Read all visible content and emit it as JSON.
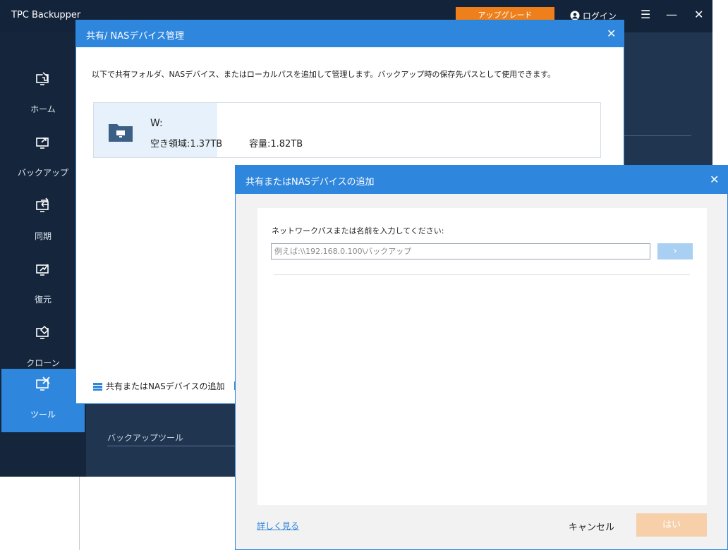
{
  "app": {
    "title": "TPC Backupper",
    "upgrade_label": "アップグレード",
    "login_label": "ログイン",
    "menu_glyph": "☰",
    "minimize_glyph": "—",
    "close_glyph": "✕"
  },
  "sidebar": {
    "items": [
      {
        "label": "ホーム",
        "icon": "home-icon"
      },
      {
        "label": "バックアップ",
        "icon": "backup-icon"
      },
      {
        "label": "同期",
        "icon": "sync-icon"
      },
      {
        "label": "復元",
        "icon": "restore-icon"
      },
      {
        "label": "クローン",
        "icon": "clone-icon"
      },
      {
        "label": "ツール",
        "icon": "tools-icon",
        "active": true
      }
    ]
  },
  "content": {
    "backup_tools_label": "バックアップツール"
  },
  "nas_dialog": {
    "title": "共有/ NASデバイス管理",
    "close_glyph": "✕",
    "description": "以下で共有フォルダ、NASデバイス、またはローカルパスを追加して管理します。バックアップ時の保存先パスとして使用できます。",
    "drive": {
      "name": "W:",
      "free_space": "空き領域:1.37TB",
      "capacity": "容量:1.82TB"
    },
    "add_link_label": "共有またはNASデバイスの追加"
  },
  "add_dialog": {
    "title": "共有またはNASデバイスの追加",
    "close_glyph": "✕",
    "prompt": "ネットワークパスまたは名前を入力してください:",
    "path_placeholder": "例えば:\\\\192.168.0.100\\バックアップ",
    "path_value": "",
    "go_glyph": "›",
    "more_link": "詳しく見る",
    "cancel_label": "キャンセル",
    "ok_label": "はい"
  },
  "colors": {
    "accent": "#2f86dd",
    "sidebar_bg": "#15263c",
    "content_bg": "#1f3550",
    "upgrade": "#ef7f1a",
    "ok_disabled": "#f7cfa9"
  }
}
